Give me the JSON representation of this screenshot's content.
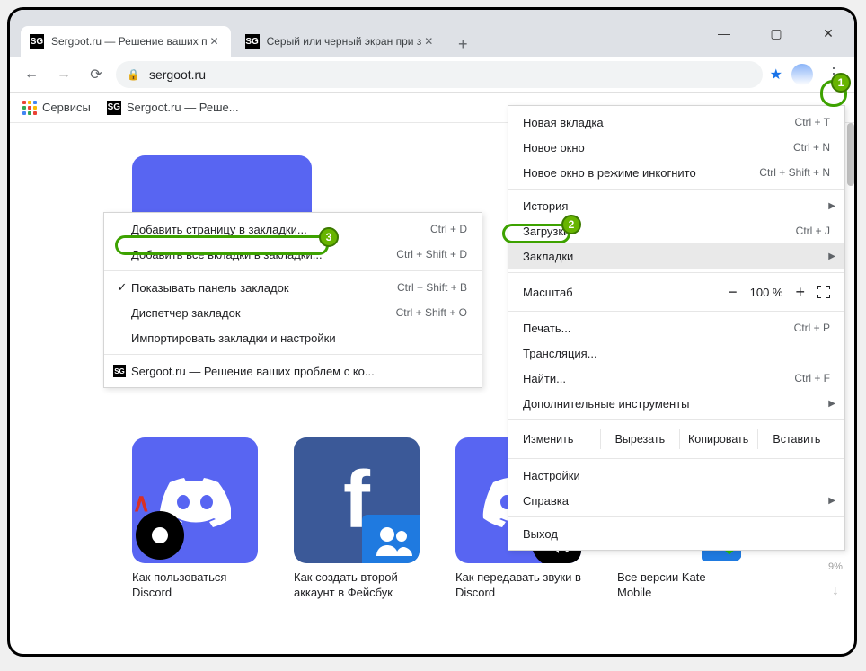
{
  "tabs": [
    {
      "favicon": "SG",
      "title": "Sergoot.ru — Решение ваших п"
    },
    {
      "favicon": "SG",
      "title": "Серый или черный экран при з"
    }
  ],
  "address": {
    "domain": "sergoot.ru"
  },
  "bookmarks_bar": {
    "apps_label": "Сервисы",
    "item1": "Sergoot.ru — Реше..."
  },
  "main_menu": {
    "new_tab": {
      "label": "Новая вкладка",
      "shortcut": "Ctrl + T"
    },
    "new_window": {
      "label": "Новое окно",
      "shortcut": "Ctrl + N"
    },
    "incognito": {
      "label": "Новое окно в режиме инкогнито",
      "shortcut": "Ctrl + Shift + N"
    },
    "history": {
      "label": "История"
    },
    "downloads": {
      "label": "Загрузки",
      "shortcut": "Ctrl + J"
    },
    "bookmarks": {
      "label": "Закладки"
    },
    "zoom_label": "Масштаб",
    "zoom_value": "100 %",
    "print": {
      "label": "Печать...",
      "shortcut": "Ctrl + P"
    },
    "cast": {
      "label": "Трансляция..."
    },
    "find": {
      "label": "Найти...",
      "shortcut": "Ctrl + F"
    },
    "more_tools": {
      "label": "Дополнительные инструменты"
    },
    "edit_label": "Изменить",
    "cut": "Вырезать",
    "copy": "Копировать",
    "paste": "Вставить",
    "settings": {
      "label": "Настройки"
    },
    "help": {
      "label": "Справка"
    },
    "exit": {
      "label": "Выход"
    }
  },
  "bookmarks_submenu": {
    "add_page": {
      "label": "Добавить страницу в закладки...",
      "shortcut": "Ctrl + D"
    },
    "add_all": {
      "label": "Добавить все вкладки в закладки...",
      "shortcut": "Ctrl + Shift + D"
    },
    "show_bar": {
      "label": "Показывать панель закладок",
      "shortcut": "Ctrl + Shift + B"
    },
    "manager": {
      "label": "Диспетчер закладок",
      "shortcut": "Ctrl + Shift + O"
    },
    "import": {
      "label": "Импортировать закладки и настройки"
    },
    "site1": "Sergoot.ru — Решение ваших проблем с ко..."
  },
  "tiles": [
    {
      "caption": "Как пользоваться Discord"
    },
    {
      "caption": "Как создать второй аккаунт в Фейсбук"
    },
    {
      "caption": "Как передавать звуки в Discord"
    },
    {
      "caption": "Все версии Kate Mobile"
    }
  ],
  "scroll_pct": "9%",
  "callouts": {
    "n1": "1",
    "n2": "2",
    "n3": "3"
  }
}
